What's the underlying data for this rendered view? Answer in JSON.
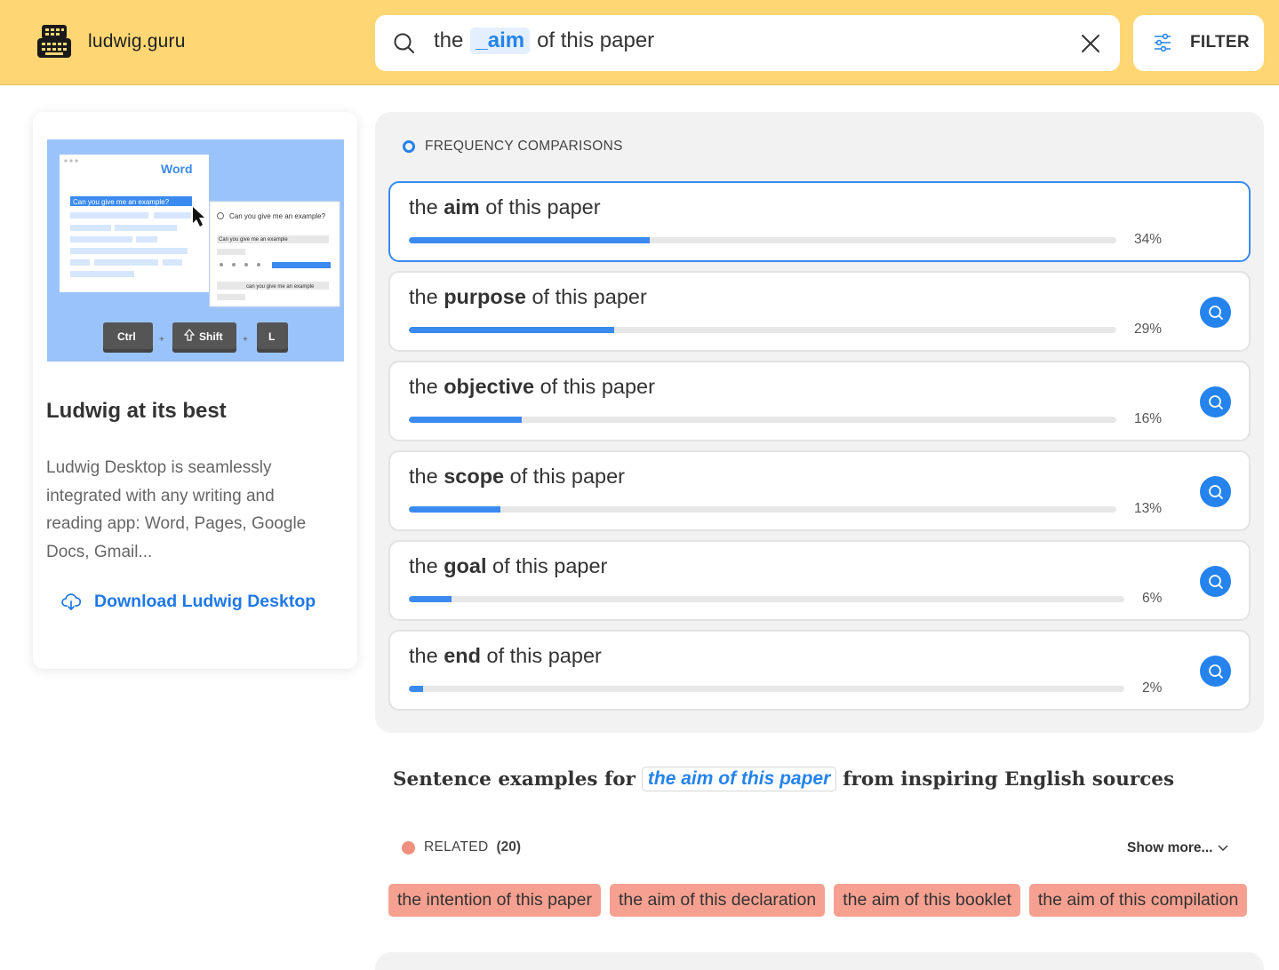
{
  "header": {
    "site_name": "ludwig.guru",
    "search": {
      "before": "the",
      "token": "_aim",
      "after": "of this paper"
    },
    "filter_label": "FILTER",
    "colors": {
      "background": "#fed774",
      "accent": "#2583ed"
    }
  },
  "sidebar": {
    "illustration": {
      "app_label": "Word",
      "highlight_text": "Can you give me an example?",
      "popup_search": "Can you give me an example?",
      "popup_result": "Can you give me an example",
      "popup_result2": "can you give me an example",
      "keys": [
        "Ctrl",
        "Shift",
        "L"
      ]
    },
    "title": "Ludwig at its best",
    "description": "Ludwig Desktop is seamlessly integrated with any writing and reading app: Word, Pages, Google Docs, Gmail...",
    "download_label": "Download Ludwig Desktop"
  },
  "frequency": {
    "heading": "FREQUENCY COMPARISONS",
    "rows": [
      {
        "pre": "the",
        "word": "aim",
        "post": "of this paper",
        "percent_label": "34%",
        "percent": 34,
        "active": true
      },
      {
        "pre": "the",
        "word": "purpose",
        "post": "of this paper",
        "percent_label": "29%",
        "percent": 29,
        "active": false
      },
      {
        "pre": "the",
        "word": "objective",
        "post": "of this paper",
        "percent_label": "16%",
        "percent": 16,
        "active": false
      },
      {
        "pre": "the",
        "word": "scope",
        "post": "of this paper",
        "percent_label": "13%",
        "percent": 13,
        "active": false
      },
      {
        "pre": "the",
        "word": "goal",
        "post": "of this paper",
        "percent_label": "6%",
        "percent": 6,
        "active": false
      },
      {
        "pre": "the",
        "word": "end",
        "post": "of this paper",
        "percent_label": "2%",
        "percent": 2,
        "active": false
      }
    ]
  },
  "examples": {
    "prefix": "Sentence examples for",
    "phrase": "the aim of this paper",
    "suffix": "from inspiring English sources"
  },
  "related": {
    "label": "RELATED",
    "count": "(20)",
    "show_more": "Show more...",
    "tags": [
      "the intention of this paper",
      "the aim of this declaration",
      "the aim of this booklet",
      "the aim of this compilation"
    ]
  }
}
